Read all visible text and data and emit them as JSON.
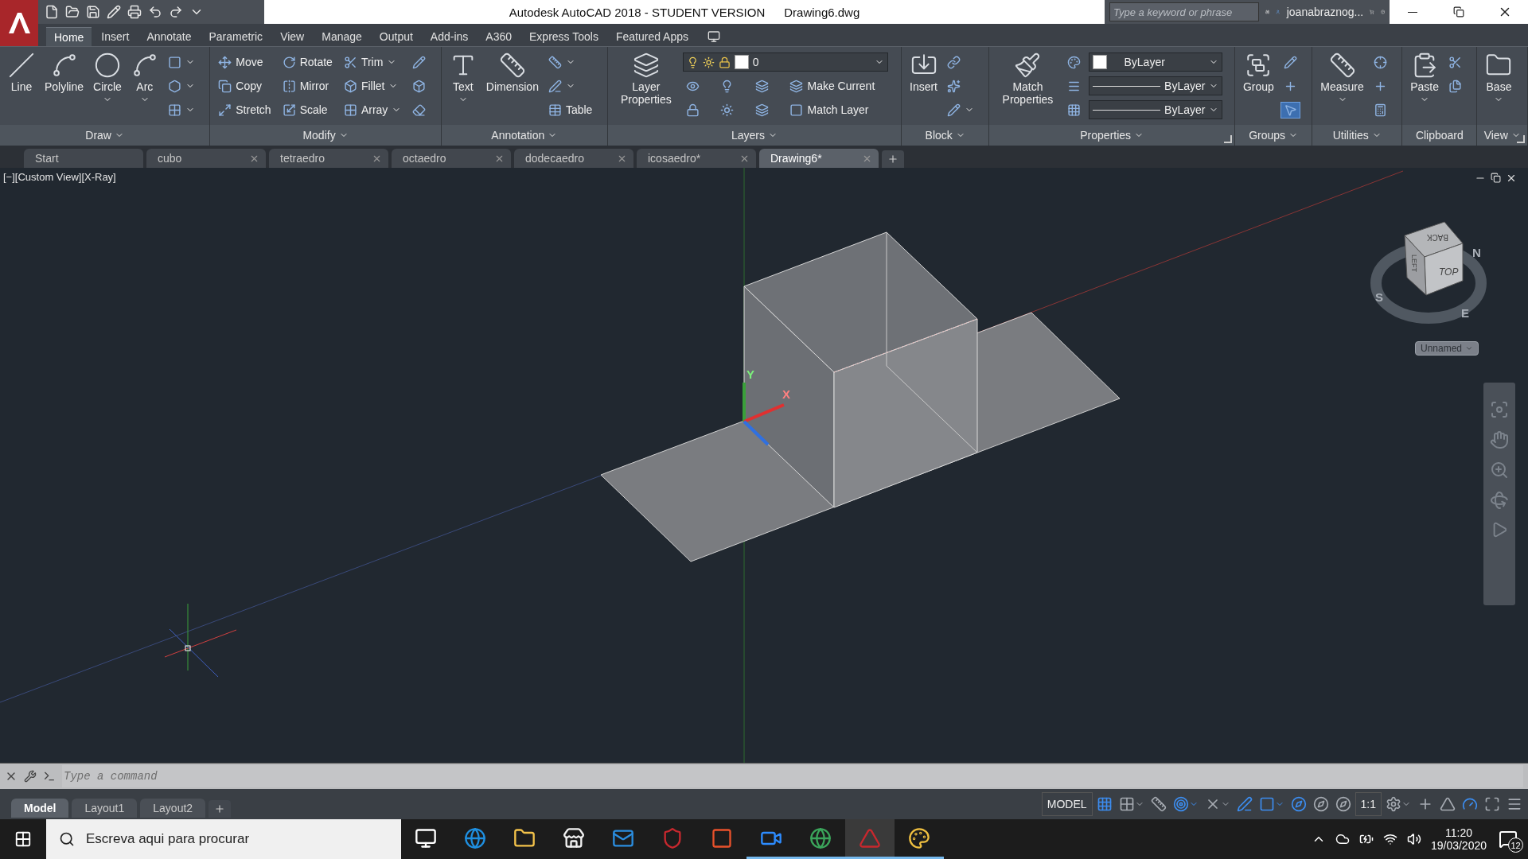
{
  "title_bar": {
    "title": "Autodesk AutoCAD 2018 - STUDENT VERSION",
    "file": "Drawing6.dwg",
    "search": {
      "placeholder": "Type a keyword or phrase"
    },
    "user": "joanabraznog..."
  },
  "ribbon": {
    "tabs": [
      {
        "label": "Home",
        "selected": true
      },
      {
        "label": "Insert",
        "selected": false
      },
      {
        "label": "Annotate",
        "selected": false
      },
      {
        "label": "Parametric",
        "selected": false
      },
      {
        "label": "View",
        "selected": false
      },
      {
        "label": "Manage",
        "selected": false
      },
      {
        "label": "Output",
        "selected": false
      },
      {
        "label": "Add-ins",
        "selected": false
      },
      {
        "label": "A360",
        "selected": false
      },
      {
        "label": "Express Tools",
        "selected": false
      },
      {
        "label": "Featured Apps",
        "selected": false
      }
    ],
    "panels": [
      {
        "title": "Draw",
        "dropdown": true,
        "launcher": false,
        "large": [
          {
            "kind": "large",
            "label": "Line",
            "dropdown": false
          },
          {
            "kind": "large",
            "label": "Polyline",
            "dropdown": false
          },
          {
            "kind": "large",
            "label": "Circle",
            "dropdown": true
          },
          {
            "kind": "large",
            "label": "Arc",
            "dropdown": true
          }
        ],
        "rows": [
          [
            {
              "kind": "small",
              "dropdown": true
            }
          ],
          [
            {
              "kind": "small",
              "dropdown": true
            }
          ],
          [
            {
              "kind": "small",
              "dropdown": true
            }
          ]
        ]
      },
      {
        "title": "Modify",
        "dropdown": true,
        "launcher": false,
        "rows": [
          [
            {
              "kind": "small",
              "label": "Move",
              "dropdown": false
            },
            {
              "kind": "small",
              "label": "Rotate",
              "dropdown": false
            },
            {
              "kind": "small",
              "label": "Trim",
              "dropdown": true
            },
            {
              "kind": "small",
              "dropdown": false
            }
          ],
          [
            {
              "kind": "small",
              "label": "Copy",
              "dropdown": false
            },
            {
              "kind": "small",
              "label": "Mirror",
              "dropdown": false
            },
            {
              "kind": "small",
              "label": "Fillet",
              "dropdown": true
            },
            {
              "kind": "small",
              "dropdown": false
            }
          ],
          [
            {
              "kind": "small",
              "label": "Stretch",
              "dropdown": false
            },
            {
              "kind": "small",
              "label": "Scale",
              "dropdown": false
            },
            {
              "kind": "small",
              "label": "Array",
              "dropdown": true
            },
            {
              "kind": "small",
              "dropdown": false
            }
          ]
        ]
      },
      {
        "title": "Annotation",
        "dropdown": true,
        "launcher": false,
        "large": [
          {
            "kind": "large",
            "label": "Text",
            "dropdown": true
          },
          {
            "kind": "large",
            "label": "Dimension",
            "dropdown": false
          }
        ],
        "rows": [
          [
            {
              "kind": "small",
              "dropdown": true
            }
          ],
          [
            {
              "kind": "small",
              "dropdown": true
            }
          ],
          [
            {
              "kind": "small",
              "label": "Table",
              "dropdown": false
            }
          ]
        ]
      },
      {
        "title": "Layers",
        "dropdown": true,
        "launcher": false,
        "large": [
          {
            "kind": "large",
            "label": "Layer Properties",
            "dropdown": false
          }
        ],
        "rows": [
          [
            {
              "kind": "layer-combo",
              "value": "0"
            }
          ],
          [
            {
              "kind": "small",
              "dropdown": false
            },
            {
              "kind": "small",
              "dropdown": false
            },
            {
              "kind": "small",
              "dropdown": false
            },
            {
              "kind": "small",
              "label": "Make Current",
              "dropdown": false
            }
          ],
          [
            {
              "kind": "small",
              "dropdown": false
            },
            {
              "kind": "small",
              "dropdown": false
            },
            {
              "kind": "small",
              "dropdown": false
            },
            {
              "kind": "small",
              "label": "Match Layer",
              "dropdown": false
            }
          ]
        ]
      },
      {
        "title": "Block",
        "dropdown": true,
        "launcher": false,
        "large": [
          {
            "kind": "large",
            "label": "Insert",
            "dropdown": false
          }
        ],
        "rows": [
          [
            {
              "kind": "small",
              "dropdown": false
            }
          ],
          [
            {
              "kind": "small",
              "dropdown": false
            }
          ],
          [
            {
              "kind": "small",
              "dropdown": true
            }
          ]
        ]
      },
      {
        "title": "Properties",
        "dropdown": true,
        "launcher": true,
        "large": [
          {
            "kind": "large",
            "label": "Match Properties",
            "dropdown": false
          }
        ],
        "rows": [
          [
            {
              "kind": "small",
              "dropdown": false
            },
            {
              "kind": "color-combo",
              "value": "ByLayer"
            }
          ],
          [
            {
              "kind": "small",
              "dropdown": false
            },
            {
              "kind": "line-combo",
              "value": "ByLayer"
            }
          ],
          [
            {
              "kind": "small",
              "dropdown": false
            },
            {
              "kind": "line-combo",
              "value": "ByLayer"
            }
          ]
        ]
      },
      {
        "title": "Groups",
        "dropdown": true,
        "launcher": false,
        "large": [
          {
            "kind": "large",
            "label": "Group",
            "dropdown": false
          }
        ],
        "rows": [
          [
            {
              "kind": "small",
              "dropdown": false,
              "on": false
            }
          ],
          [
            {
              "kind": "small",
              "dropdown": false,
              "on": false
            }
          ],
          [
            {
              "kind": "small",
              "dropdown": false,
              "on": true
            }
          ]
        ]
      },
      {
        "title": "Utilities",
        "dropdown": true,
        "launcher": false,
        "large": [
          {
            "kind": "large",
            "label": "Measure",
            "dropdown": true
          }
        ],
        "rows": [
          [
            {
              "kind": "small",
              "dropdown": false
            }
          ],
          [
            {
              "kind": "small",
              "dropdown": false
            }
          ],
          [
            {
              "kind": "small",
              "dropdown": false
            }
          ]
        ]
      },
      {
        "title": "Clipboard",
        "dropdown": false,
        "launcher": false,
        "large": [
          {
            "kind": "large",
            "label": "Paste",
            "dropdown": true
          }
        ],
        "rows": [
          [
            {
              "kind": "small",
              "dropdown": false
            }
          ],
          [
            {
              "kind": "small",
              "dropdown": false
            }
          ]
        ]
      },
      {
        "title": "View",
        "dropdown": true,
        "launcher": true,
        "large": [
          {
            "kind": "large",
            "label": "Base",
            "dropdown": true
          }
        ]
      }
    ]
  },
  "document_tabs": [
    {
      "label": "Start",
      "closable": false,
      "selected": false
    },
    {
      "label": "cubo",
      "closable": true,
      "selected": false
    },
    {
      "label": "tetraedro",
      "closable": true,
      "selected": false
    },
    {
      "label": "octaedro",
      "closable": true,
      "selected": false
    },
    {
      "label": "dodecaedro",
      "closable": true,
      "selected": false
    },
    {
      "label": "icosaedro*",
      "closable": true,
      "selected": false
    },
    {
      "label": "Drawing6*",
      "closable": true,
      "selected": true
    }
  ],
  "viewport": {
    "label": "[−][Custom View][X-Ray]",
    "ucs": {
      "x": "X",
      "y": "Y"
    },
    "viewcube": {
      "faces": [
        "TOP",
        "BACK",
        "LEFT"
      ],
      "compass": [
        "N",
        "S",
        "E"
      ],
      "view_name": "Unnamed"
    }
  },
  "command_line": {
    "placeholder": "Type a command"
  },
  "layout_tabs": [
    {
      "label": "Model",
      "selected": true
    },
    {
      "label": "Layout1",
      "selected": false
    },
    {
      "label": "Layout2",
      "selected": false
    }
  ],
  "status_bar": {
    "space": "MODEL",
    "toggles_left": [
      {
        "on": true,
        "dropdown": false
      },
      {
        "on": false,
        "dropdown": true
      },
      {
        "on": false,
        "dropdown": false
      },
      {
        "on": true,
        "dropdown": true
      },
      {
        "on": false,
        "dropdown": true
      },
      {
        "on": true,
        "dropdown": false
      },
      {
        "on": true,
        "dropdown": true
      },
      {
        "on": true,
        "dropdown": false
      },
      {
        "on": false,
        "dropdown": false
      },
      {
        "on": false,
        "dropdown": false
      }
    ],
    "annotation_scale": "1:1",
    "toggles_right": [
      {
        "on": false,
        "dropdown": true
      },
      {
        "on": false,
        "dropdown": false
      },
      {
        "on": false,
        "dropdown": false
      },
      {
        "on": true,
        "dropdown": false
      },
      {
        "on": false,
        "dropdown": false
      },
      {
        "on": false,
        "dropdown": false
      }
    ]
  },
  "taskbar": {
    "search": {
      "placeholder": "Escreva aqui para procurar"
    },
    "apps": [
      {
        "running": false,
        "selected": false
      },
      {
        "running": false,
        "selected": false
      },
      {
        "running": false,
        "selected": false
      },
      {
        "running": false,
        "selected": false
      },
      {
        "running": false,
        "selected": false
      },
      {
        "running": false,
        "selected": false
      },
      {
        "running": false,
        "selected": false
      },
      {
        "running": true,
        "selected": false
      },
      {
        "running": true,
        "selected": false
      },
      {
        "running": true,
        "selected": true
      },
      {
        "running": true,
        "selected": false
      }
    ],
    "time": "11:20",
    "date": "19/03/2020",
    "notifications": "12"
  }
}
